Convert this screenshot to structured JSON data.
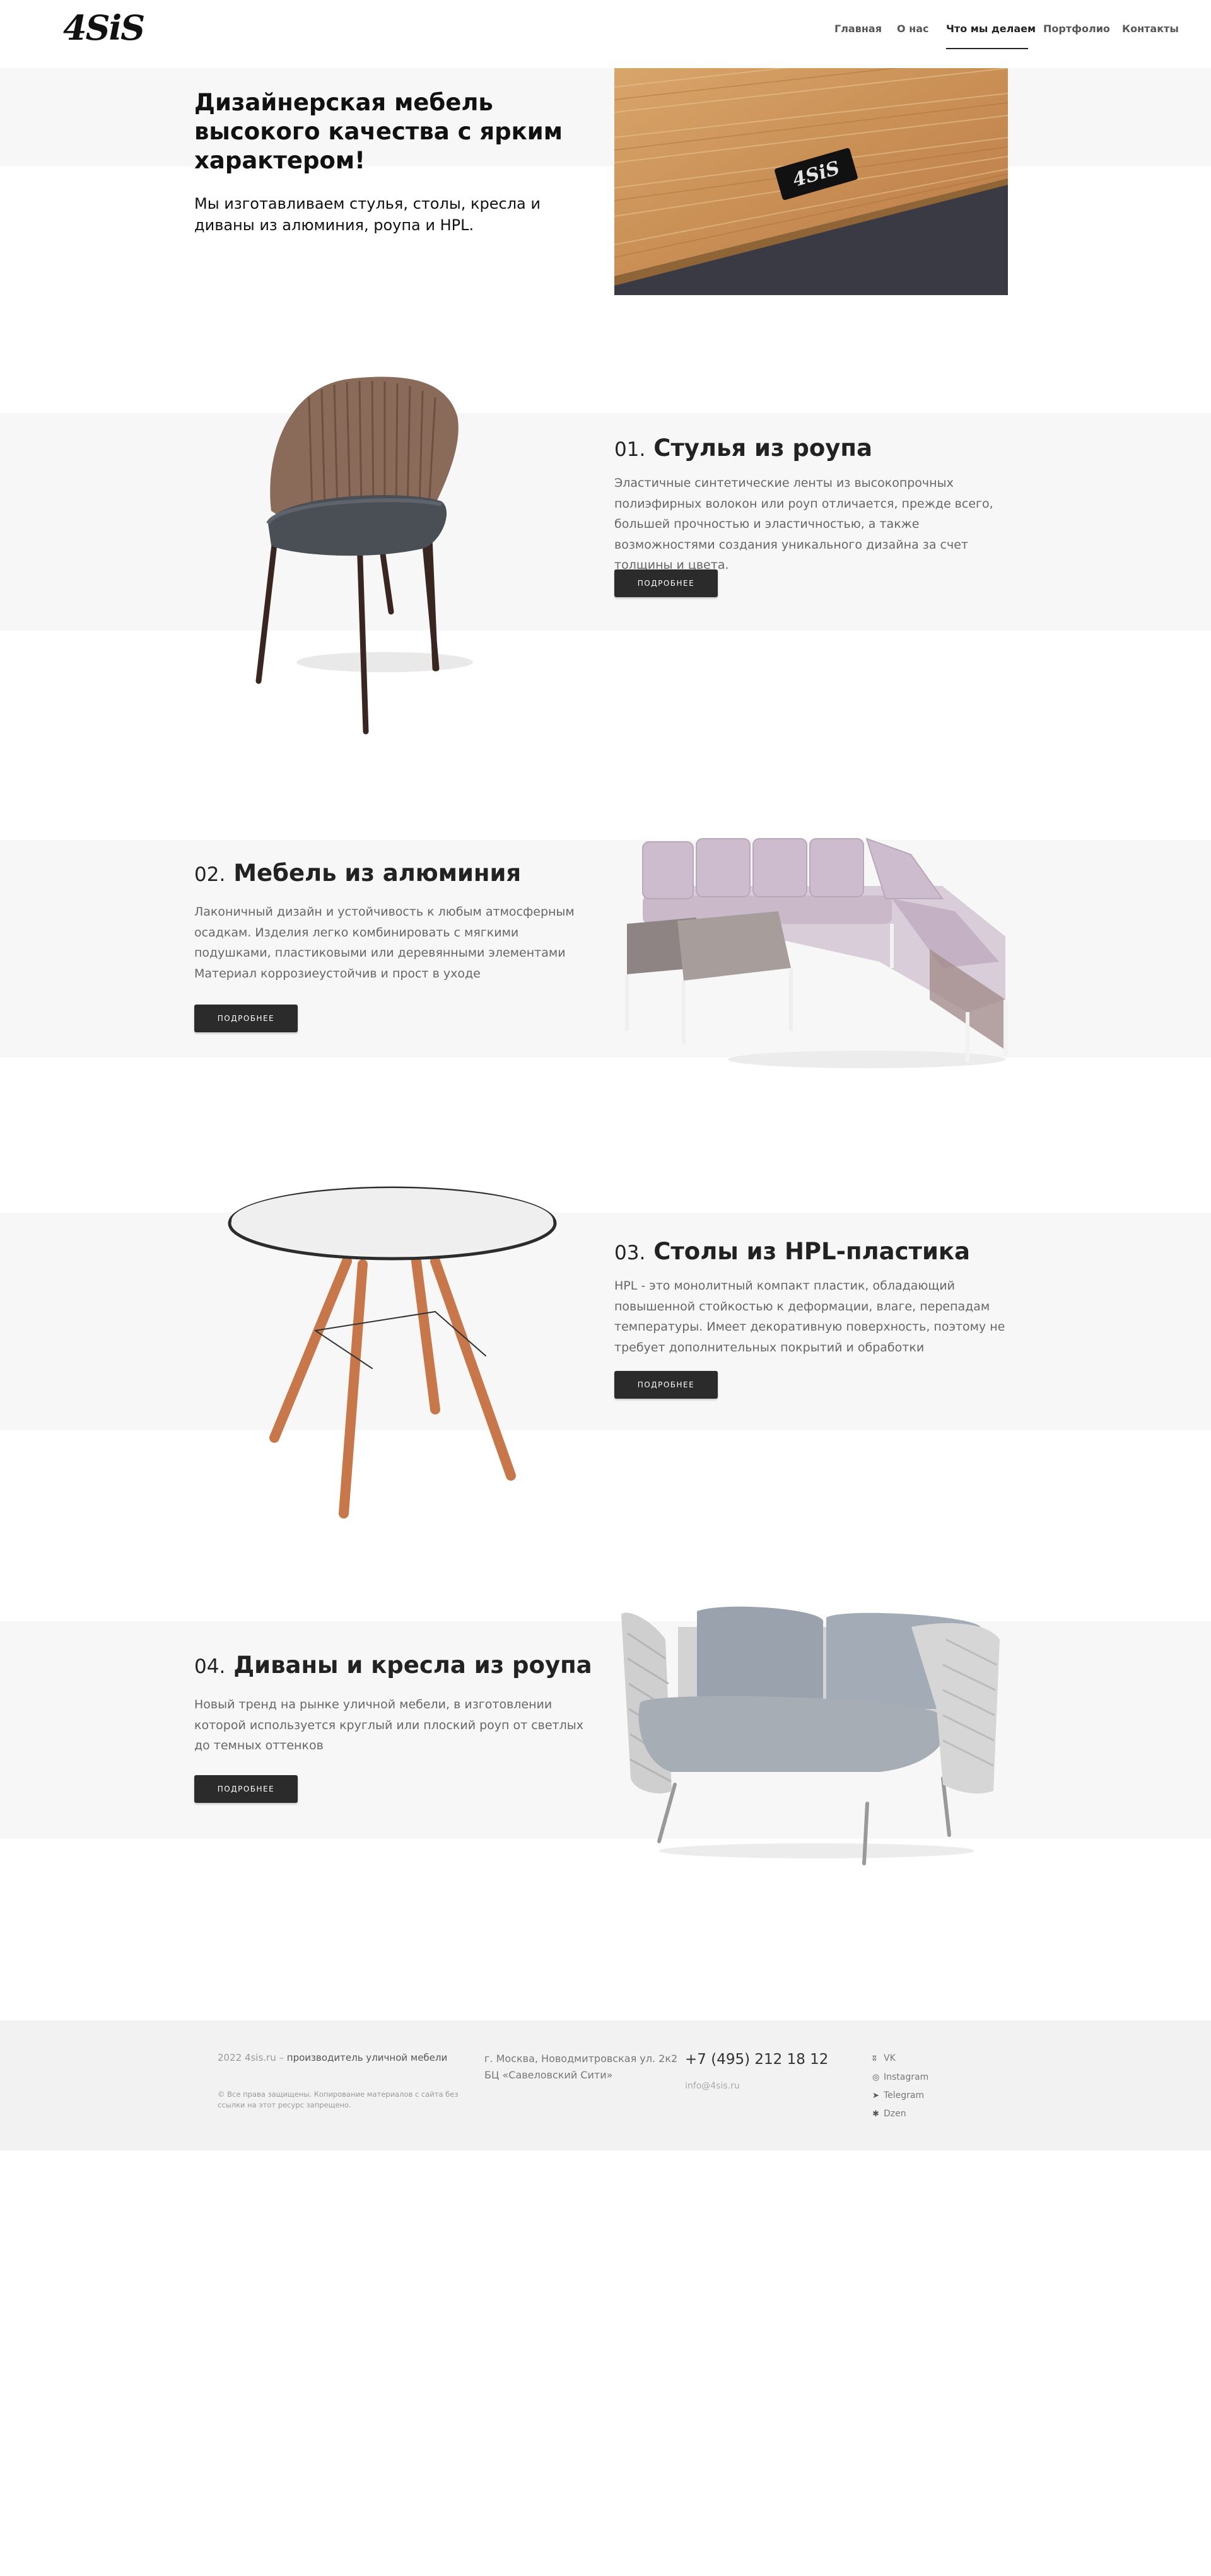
{
  "header": {
    "logo": "4SiS",
    "nav": [
      "Главная",
      "О нас",
      "Что мы делаем",
      "Портфолио",
      "Контакты"
    ]
  },
  "hero": {
    "title": "Дизайнерская мебель высокого качества с ярким характером!",
    "subtitle": "Мы изготавливаем стулья, столы, кресла и диваны из алюминия, роупа и HPL.",
    "photo_label": "4SiS"
  },
  "sections": [
    {
      "num": "01.",
      "title": "Стулья из роупа",
      "text": "Эластичные синтетические ленты из высокопрочных полиэфирных волокон или роуп отличается, прежде всего, большей прочностью и эластичностью, а также возможностями создания уникального дизайна за счет толщины и цвета.",
      "button": "ПОДРОБНЕЕ"
    },
    {
      "num": "02.",
      "title": "Мебель из алюминия",
      "text": "Лаконичный дизайн и устойчивость к любым атмосферным осадкам. Изделия легко комбинировать с мягкими подушками, пластиковыми или деревянными элементами",
      "text2": "Материал коррозиеустойчив и прост в уходе",
      "button": "ПОДРОБНЕЕ"
    },
    {
      "num": "03.",
      "title": "Столы из HPL-пластика",
      "text": "HPL - это монолитный компакт пластик, обладающий повышенной стойкостью к деформации, влаге, перепадам температуры. Имеет декоративную поверхность, поэтому не требует дополнительных покрытий и обработки",
      "button": "ПОДРОБНЕЕ"
    },
    {
      "num": "04.",
      "title": "Диваны и кресла из роупа",
      "text": "Новый тренд на рынке уличной мебели, в изготовлении которой используется круглый или плоский роуп от светлых до темных оттенков",
      "button": "ПОДРОБНЕЕ"
    }
  ],
  "footer": {
    "brand_prefix": "2022 4sis.ru –",
    "brand_text": "производитель уличной мебели",
    "copyright": "© Все права защищены. Копирование материалов с сайта без ссылки на этот ресурс запрещено.",
    "address": "г. Москва, Новодмитровская ул. 2к2 БЦ «Савеловский Сити»",
    "phone": "+7 (495) 212 18 12",
    "email": "info@4sis.ru",
    "social": [
      {
        "icon": "vk-icon",
        "label": "VK"
      },
      {
        "icon": "instagram-icon",
        "label": "Instagram"
      },
      {
        "icon": "telegram-icon",
        "label": "Telegram"
      },
      {
        "icon": "dzen-icon",
        "label": "Dzen"
      }
    ]
  }
}
